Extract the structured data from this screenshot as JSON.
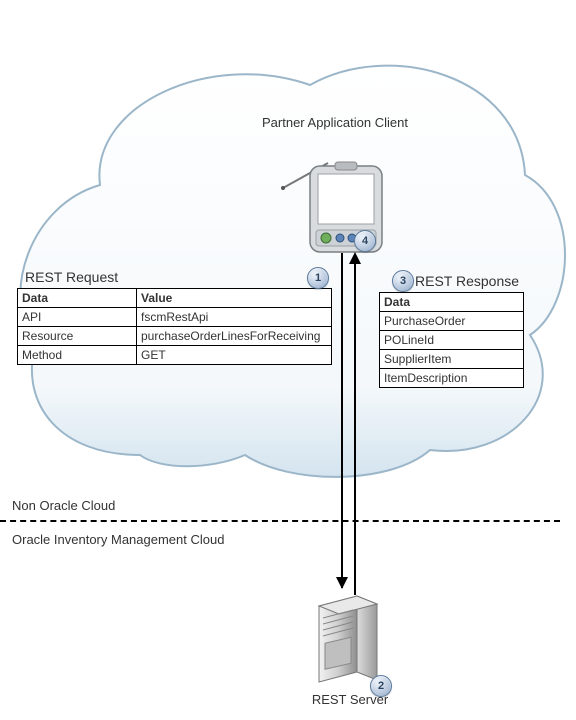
{
  "diagram": {
    "client_label": "Partner Application Client",
    "server_label": "REST Server",
    "zone_upper": "Non Oracle Cloud",
    "zone_lower": "Oracle Inventory Management Cloud"
  },
  "request": {
    "title": "REST Request",
    "headers": {
      "data": "Data",
      "value": "Value"
    },
    "rows": [
      {
        "data": "API",
        "value": "fscmRestApi"
      },
      {
        "data": "Resource",
        "value": "purchaseOrderLinesForReceiving"
      },
      {
        "data": "Method",
        "value": "GET"
      }
    ]
  },
  "response": {
    "title": "REST Response",
    "header": "Data",
    "rows": [
      "PurchaseOrder",
      "POLineId",
      "SupplierItem",
      "ItemDescription"
    ]
  },
  "steps": {
    "s1": "1",
    "s2": "2",
    "s3": "3",
    "s4": "4"
  }
}
